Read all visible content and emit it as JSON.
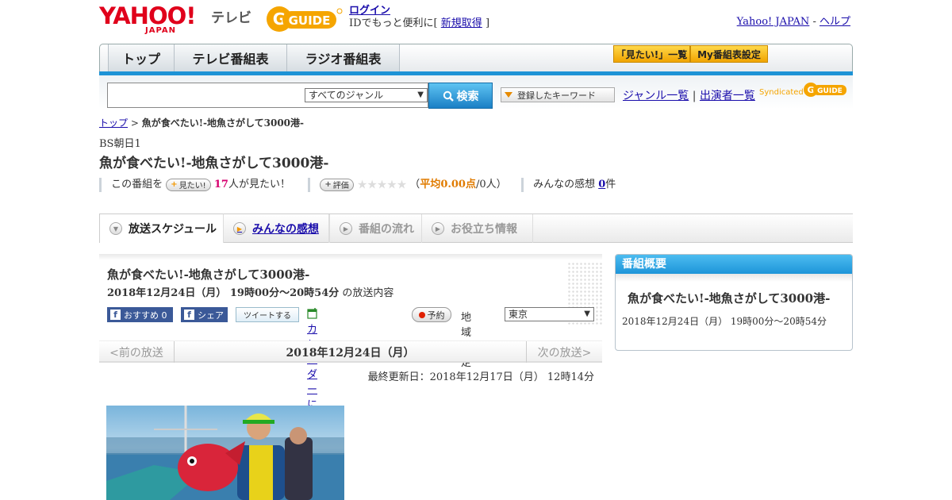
{
  "header": {
    "logo_yahoo": "YAHOO!",
    "logo_yahoo_sub": "JAPAN",
    "logo_tv": "テレビ",
    "logo_gguide": "GUIDE",
    "login_label": "ログイン",
    "id_prefix": "IDでもっと便利に[",
    "register_label": "新規取得",
    "id_suffix": "]",
    "yahoo_japan_link": "Yahoo! JAPAN",
    "separator": "-",
    "help_link": "ヘルプ"
  },
  "nav": {
    "tabs": [
      "トップ",
      "テレビ番組表",
      "ラジオ番組表"
    ],
    "btn_mitai": "「見たい!」一覧",
    "btn_my": "My番組表設定"
  },
  "search": {
    "input_value": "",
    "genre_selected": "すべてのジャンル",
    "search_button": "検索",
    "keyword_button": "登録したキーワード",
    "genre_list": "ジャンル一覧",
    "pipe": "|",
    "performer_list": "出演者一覧",
    "syndicated": "Syndicated",
    "gguide": "GUIDE"
  },
  "breadcrumb": {
    "top": "トップ",
    "sep": ">",
    "current": "魚が食べたい!-地魚さがして3000港-"
  },
  "program": {
    "channel": "BS朝日1",
    "title": "魚が食べたい!-地魚さがして3000港-",
    "mitai_prefix": "この番組を",
    "mitai_button": "見たい!",
    "mitai_count": "17",
    "mitai_suffix": "人が見たい！",
    "rate_button": "評価",
    "stars": "★★★★★",
    "avg_open": "（",
    "avg_label": "平均0.00点",
    "avg_suffix": "/0人）",
    "comments_prefix": "みんなの感想",
    "comments_count": "0",
    "comments_suffix": "件"
  },
  "tabs": {
    "schedule": "放送スケジュール",
    "comments": "みんなの感想",
    "flow": "番組の流れ",
    "info": "お役立ち情報"
  },
  "detail": {
    "title": "魚が食べたい!-地魚さがして3000港-",
    "datetime": "2018年12月24日（月） 19時00分～20時54分",
    "datetime_suffix": "の放送内容",
    "recommend": "おすすめ 0",
    "share": "シェア",
    "tweet": "ツイートする",
    "calendar": "カレンダーに登録",
    "reserve": "予約",
    "region_label": "地域設定",
    "region_value": "東京",
    "pager_prev": "<前の放送",
    "pager_current": "2018年12月24日（月）",
    "pager_next": "次の放送>",
    "last_updated": "最終更新日：2018年12月17日（月） 12時14分"
  },
  "overview": {
    "heading": "番組概要",
    "title": "魚が食べたい!-地魚さがして3000港-",
    "time": "2018年12月24日（月） 19時00分～20時54分"
  },
  "colors": {
    "accent_blue": "#1d93d6",
    "yahoo_red": "#e0001b",
    "gguide_yellow": "#f5a500",
    "link": "#1a0dab"
  }
}
